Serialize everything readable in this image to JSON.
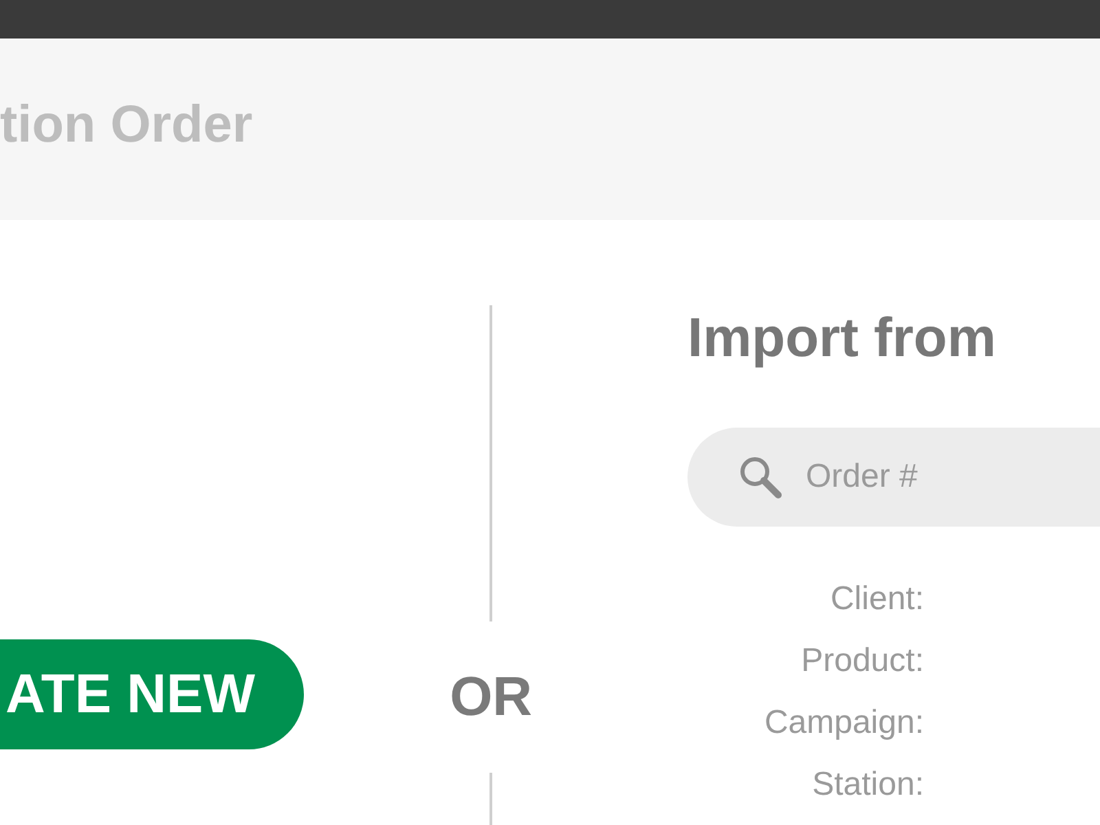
{
  "dialog": {
    "title": "tion Order"
  },
  "create": {
    "button": "ATE NEW"
  },
  "separator": {
    "label": "OR"
  },
  "import": {
    "title": "Import from",
    "search": {
      "placeholder": "Order #"
    },
    "fields": [
      {
        "label": "Client:"
      },
      {
        "label": "Product:"
      },
      {
        "label": "Campaign:"
      },
      {
        "label": "Station:"
      }
    ]
  }
}
